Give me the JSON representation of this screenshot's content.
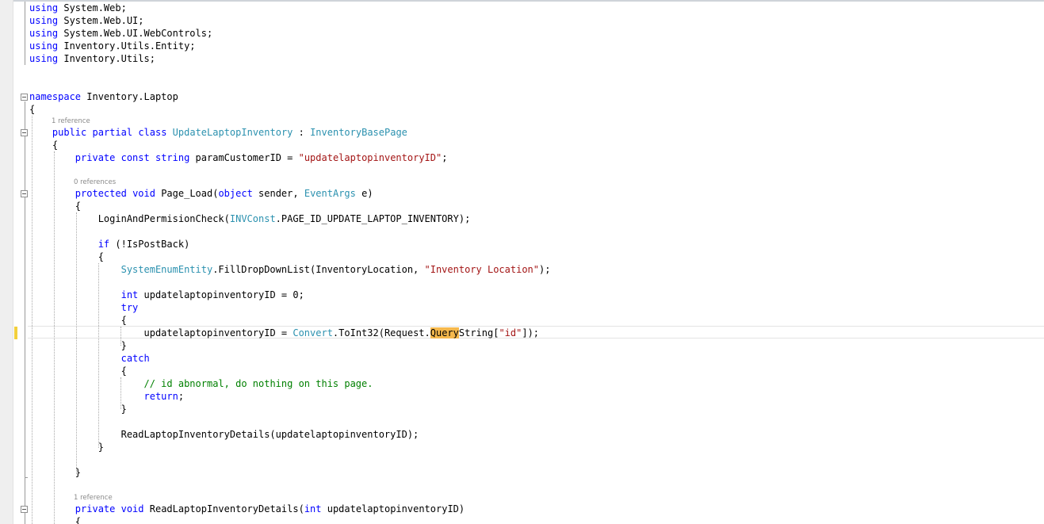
{
  "editor": {
    "language": "C#",
    "colors": {
      "keyword": "#0000ff",
      "type": "#2b91af",
      "string": "#a31515",
      "comment": "#008000",
      "text": "#000000",
      "codelens": "#8a8a8a",
      "find_highlight": "#f6b94d",
      "change_marker": "#f2d03c"
    },
    "codelens": {
      "class_refs": "1 reference",
      "page_load_refs": "0 references",
      "read_details_refs": "1 reference"
    },
    "tokens": {
      "using": "using",
      "ns_system_web": " System.Web;",
      "ns_system_web_ui": " System.Web.UI;",
      "ns_webcontrols": " System.Web.UI.WebControls;",
      "ns_utils_entity": " Inventory.Utils.Entity;",
      "ns_utils": " Inventory.Utils;",
      "namespace_kw": "namespace",
      "namespace_name": " Inventory.Laptop",
      "brace_open": "{",
      "brace_close": "}",
      "public": "public",
      "partial": "partial",
      "class": "class",
      "class_name": "UpdateLaptopInventory",
      "colon": " : ",
      "base_class": "InventoryBasePage",
      "private": "private",
      "const": "const",
      "string": "string",
      "param_decl": " paramCustomerID = ",
      "param_value": "\"updatelaptopinventoryID\"",
      "semicolon": ";",
      "protected": "protected",
      "void": "void",
      "page_load": " Page_Load(",
      "object": "object",
      "sender": " sender, ",
      "event_args": "EventArgs",
      "e_paren": " e)",
      "login_call": "LoginAndPermisionCheck(",
      "inv_const": "INVConst",
      "page_id": ".PAGE_ID_UPDATE_LAPTOP_INVENTORY);",
      "if": "if",
      "is_postback": " (!IsPostBack)",
      "system_enum": "SystemEnumEntity",
      "fill_dropdown": ".FillDropDownList(InventoryLocation, ",
      "inventory_location": "\"Inventory Location\"",
      "close_paren_semi": ");",
      "int": "int",
      "int_decl": " updatelaptopinventoryID = 0;",
      "try": "try",
      "assign": "updatelaptopinventoryID = ",
      "convert": "Convert",
      "to_int32": ".ToInt32(Request.",
      "query": "Query",
      "string_idx": "String[",
      "id_literal": "\"id\"",
      "end_idx": "]);",
      "catch": "catch",
      "comment_text": "// id abnormal, do nothing on this page.",
      "return": "return",
      "read_call": "ReadLaptopInventoryDetails(updatelaptopinventoryID);",
      "read_decl": " ReadLaptopInventoryDetails(",
      "read_param": " updatelaptopinventoryID)"
    }
  }
}
